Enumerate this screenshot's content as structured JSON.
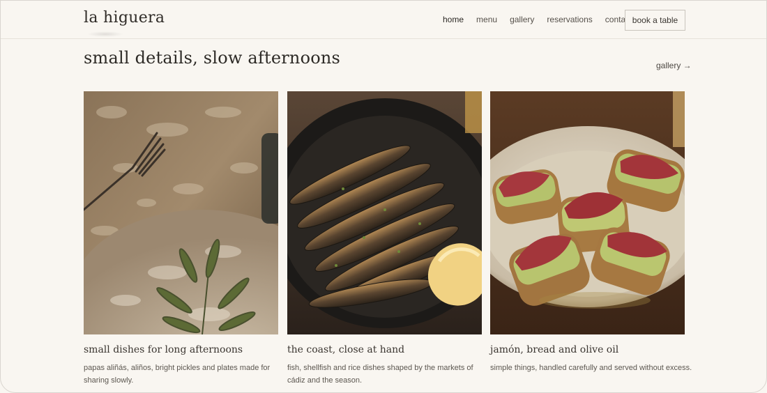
{
  "brand": {
    "logo": "la higuera"
  },
  "nav": {
    "items": [
      {
        "label": "home",
        "active": true
      },
      {
        "label": "menu"
      },
      {
        "label": "gallery"
      },
      {
        "label": "reservations"
      },
      {
        "label": "contact"
      }
    ],
    "cta": "book a table"
  },
  "section": {
    "title": "small details, slow afternoons",
    "link": "gallery →"
  },
  "cards": [
    {
      "image": "olive-branch-on-plate-photo",
      "title": "small dishes for long afternoons",
      "text": "papas aliñás, aliños, bright pickles and plates made for sharing slowly."
    },
    {
      "image": "grilled-sardines-pan-photo",
      "title": "the coast, close at hand",
      "text": "fish, shellfish and rice dishes shaped by the markets of cádiz and the season."
    },
    {
      "image": "jamon-avocado-toast-photo",
      "title": "jamón, bread and olive oil",
      "text": "simple things, handled carefully and served without excess."
    }
  ],
  "colors": {
    "background": "#f9f6f1",
    "text": "#2b2824",
    "border": "#c9c4bc"
  }
}
